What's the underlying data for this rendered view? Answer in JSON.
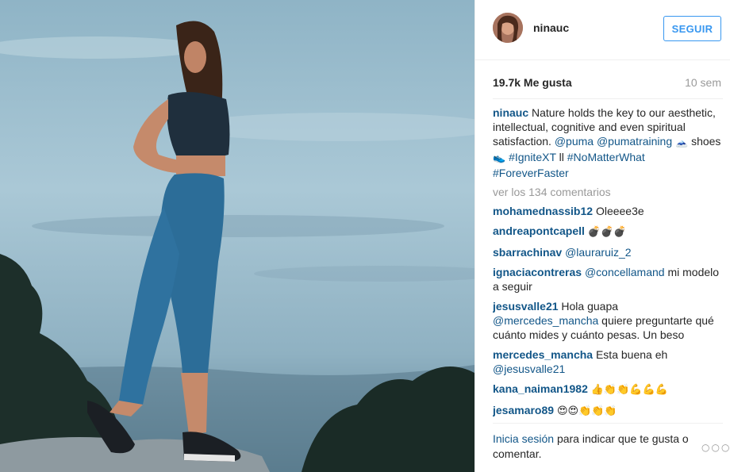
{
  "header": {
    "username": "ninauc",
    "follow_label": "SEGUIR"
  },
  "stats": {
    "likes": "19.7k Me gusta",
    "time": "10 sem"
  },
  "caption": {
    "user": "ninauc",
    "text_1": "Nature holds the key to our aesthetic, intellectual, cognitive and even spiritual satisfaction.",
    "tag_1": "@puma",
    "tag_2": "@pumatraining",
    "emoji_mountain": "🗻",
    "word_shoes": "shoes",
    "emoji_shoe": "👟",
    "tag_3": "#IgniteXT",
    "bars": "ll",
    "tag_4": "#NoMatterWhat",
    "tag_5": "#ForeverFaster"
  },
  "view_all_comments": "ver los 134 comentarios",
  "comments": [
    {
      "user": "mohamednassib12",
      "text": "Oleeee3e"
    },
    {
      "user": "andreapontcapell",
      "text": "💣💣💣"
    },
    {
      "user": "sbarrachinav",
      "tag": "@lauraruiz_2"
    },
    {
      "user": "ignaciacontreras",
      "tag": "@concellamand",
      "text": "mi modelo a seguir"
    },
    {
      "user": "jesusvalle21",
      "text_before": "Hola guapa",
      "tag": "@mercedes_mancha",
      "text": "quiere preguntarte qué cuánto mides y cuánto pesas. Un beso"
    },
    {
      "user": "mercedes_mancha",
      "text": "Esta buena eh",
      "tag": "@jesusvalle21"
    },
    {
      "user": "kana_naiman1982",
      "text": "👍👏👏💪💪💪"
    },
    {
      "user": "jesamaro89",
      "text": "😍😍👏👏👏"
    }
  ],
  "footer": {
    "login_link": "Inicia sesión",
    "login_rest": "para indicar que te gusta o comentar.",
    "more": "○○○"
  },
  "icons": {
    "more": "more-options-icon"
  },
  "colors": {
    "follow_blue": "#3897f0",
    "link_blue": "#125688",
    "muted": "#999999"
  }
}
